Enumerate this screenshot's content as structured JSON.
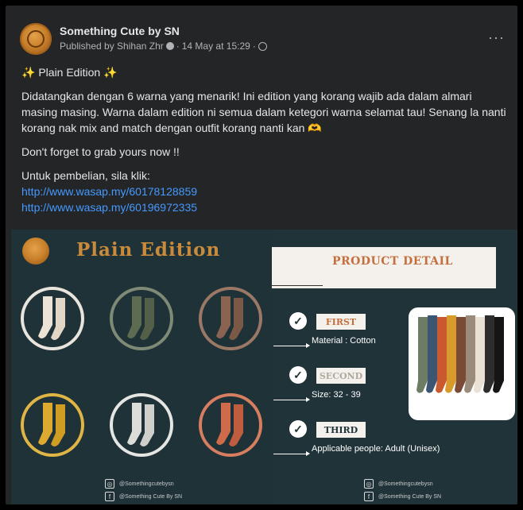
{
  "post": {
    "page_name": "Something Cute by SN",
    "published_by": "Published by Shihan Zhr",
    "separator": "·",
    "date": "14 May at 15:29",
    "more_label": "···"
  },
  "body": {
    "title_sparkle": "✨",
    "title": "Plain Edition",
    "paragraph1": "Didatangkan dengan 6 warna yang menarik! Ini edition yang korang wajib ada dalam almari masing masing. Warna dalam edition ni semua dalam ketegori warna selamat tau! Senang la nanti korang nak mix and match dengan outfit korang nanti kan 🫶",
    "paragraph2": "Don't forget to grab yours now !!",
    "purchase_label": "Untuk pembelian, sila klik:",
    "link1": "http://www.wasap.my/60178128859",
    "link2": "http://www.wasap.my/60196972335"
  },
  "image": {
    "left_title": "Plain Edition",
    "product_detail": "PRODUCT DETAIL",
    "first_label": "FIRST",
    "first_text": "Material : Cotton",
    "second_label": "SECOND",
    "second_text": "Size: 32 - 39",
    "third_label": "THIRD",
    "third_text": "Applicable people: Adult (Unisex)",
    "instagram_handle": "@Somethingcutebysn",
    "facebook_handle": "@Something Cute By SN"
  },
  "colors": {
    "sock_cream": "#ece3d6",
    "sock_green": "#5d6b51",
    "sock_brown": "#8a6450",
    "sock_yellow": "#dcaa2e",
    "sock_white": "#dcdcd8",
    "sock_orange": "#cf6a4a",
    "accent_link": "#4599ff"
  }
}
